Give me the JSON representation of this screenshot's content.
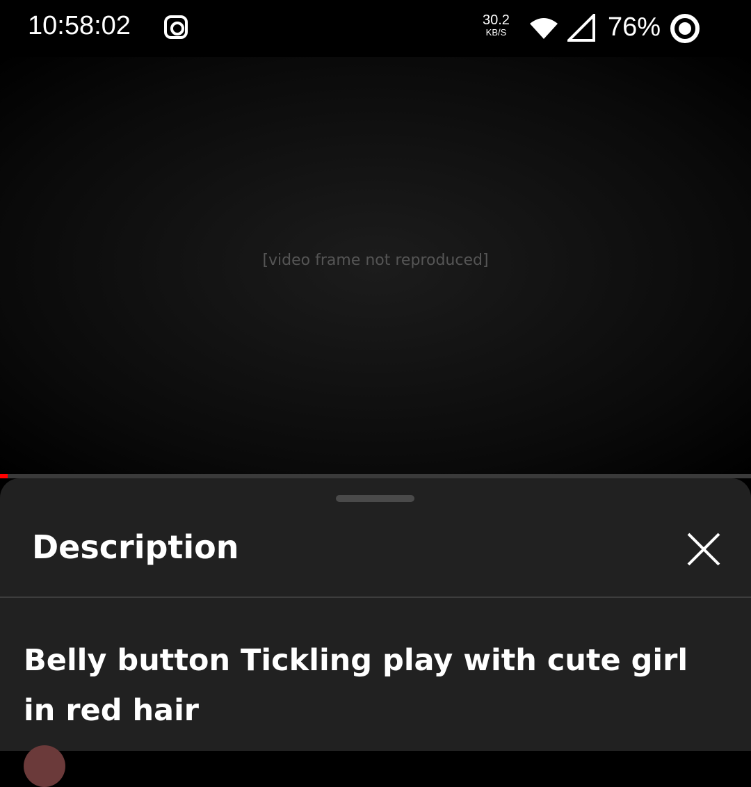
{
  "status_bar": {
    "time": "10:58:02",
    "net_speed_value": "30.2",
    "net_speed_unit": "KB/S",
    "battery": "76%",
    "icons": [
      "instagram-icon",
      "wifi-icon",
      "signal-icon",
      "battery-saver-icon"
    ]
  },
  "player": {
    "content_note": "[video frame not reproduced]",
    "progress_fraction": 0.01,
    "progress_color": "#ff0000"
  },
  "description_sheet": {
    "heading": "Description",
    "video_title": "Belly button Tickling play with cute girl in red hair"
  }
}
